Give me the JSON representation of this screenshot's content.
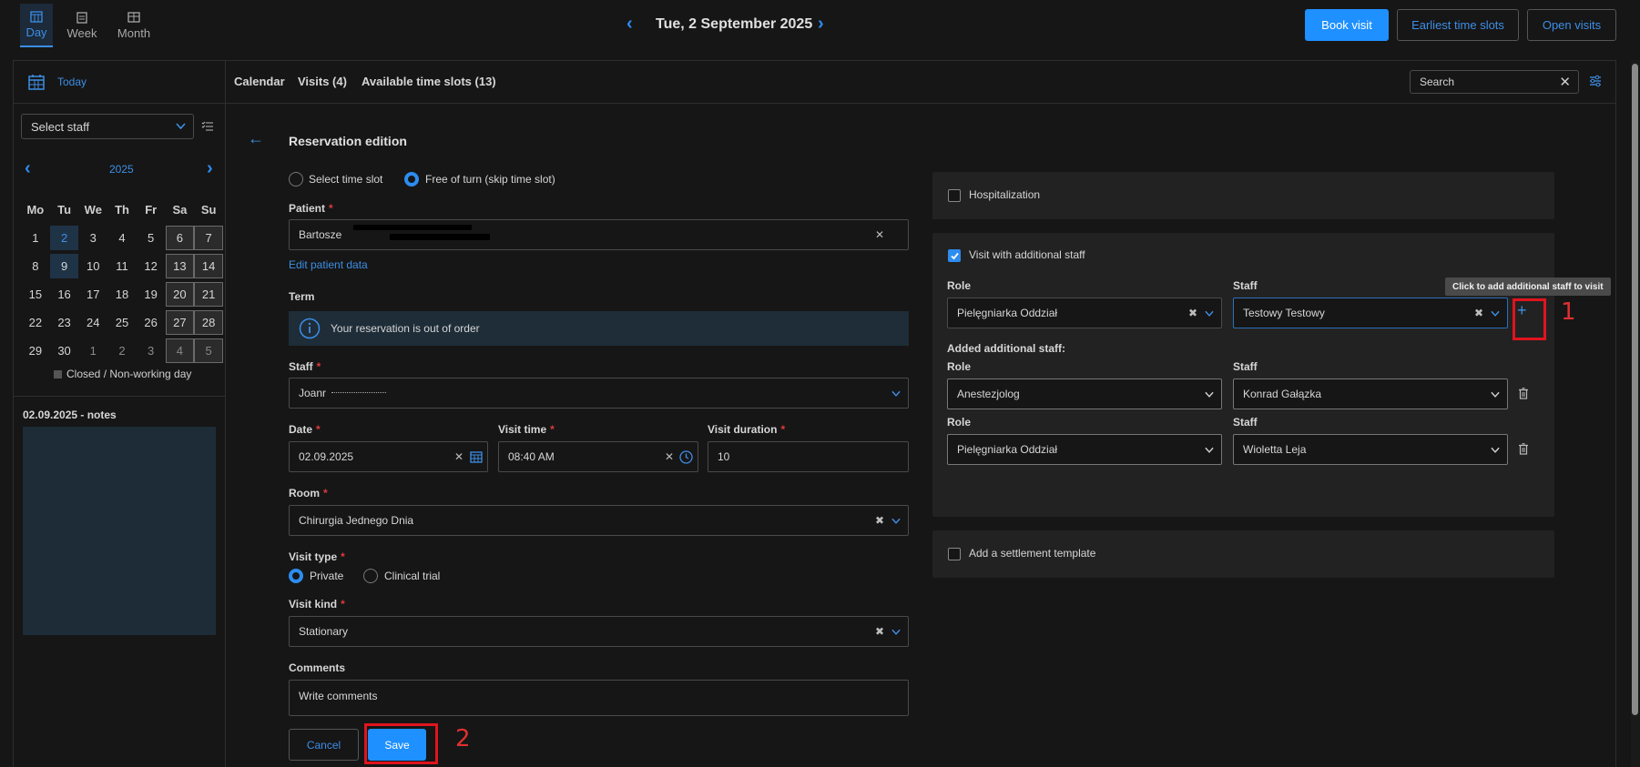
{
  "views": [
    {
      "label": "Day",
      "icon": "calendar-day-icon",
      "active": true
    },
    {
      "label": "Week",
      "icon": "calendar-week-icon",
      "active": false
    },
    {
      "label": "Month",
      "icon": "calendar-month-icon",
      "active": false
    }
  ],
  "header": {
    "date_title": "Tue, 2 September 2025"
  },
  "top_buttons": {
    "book_visit": "Book visit",
    "earliest": "Earliest time slots",
    "open_visits": "Open visits"
  },
  "sidebar": {
    "today": "Today",
    "select_staff": "Select staff",
    "year": "2025",
    "weekdays": [
      "Mo",
      "Tu",
      "We",
      "Th",
      "Fr",
      "Sa",
      "Su"
    ],
    "weeks": [
      [
        "1",
        "2",
        "3",
        "4",
        "5",
        "6",
        "7"
      ],
      [
        "8",
        "9",
        "10",
        "11",
        "12",
        "13",
        "14"
      ],
      [
        "15",
        "16",
        "17",
        "18",
        "19",
        "20",
        "21"
      ],
      [
        "22",
        "23",
        "24",
        "25",
        "26",
        "27",
        "28"
      ],
      [
        "29",
        "30",
        "1",
        "2",
        "3",
        "4",
        "5"
      ]
    ],
    "legend": "Closed / Non-working day",
    "notes_title": "02.09.2025 - notes"
  },
  "tabs": {
    "calendar": "Calendar",
    "visits": "Visits (4)",
    "slots": "Available time slots (13)"
  },
  "search": {
    "placeholder": "Search"
  },
  "form": {
    "title": "Reservation edition",
    "mode_select": "Select time slot",
    "mode_free": "Free of turn (skip time slot)",
    "patient_label": "Patient",
    "patient_value": "Bartosze",
    "edit_patient": "Edit patient data",
    "term_label": "Term",
    "info_text": "Your reservation is out of order",
    "staff_label": "Staff",
    "staff_value": "Joanr",
    "date_label": "Date",
    "date_value": "02.09.2025",
    "time_label": "Visit time",
    "time_value": "08:40 AM",
    "duration_label": "Visit duration",
    "duration_value": "10",
    "room_label": "Room",
    "room_value": "Chirurgia Jednego Dnia",
    "type_label": "Visit type",
    "type_private": "Private",
    "type_trial": "Clinical trial",
    "kind_label": "Visit kind",
    "kind_value": "Stationary",
    "comments_label": "Comments",
    "comments_placeholder": "Write comments",
    "cancel": "Cancel",
    "save": "Save"
  },
  "right": {
    "hospitalization": "Hospitalization",
    "additional_staff": "Visit with additional staff",
    "role_label": "Role",
    "staff_label": "Staff",
    "role_value": "Pielęgniarka Oddział",
    "staff_value": "Testowy Testowy",
    "add_tooltip": "Click to add additional staff to visit",
    "added_title": "Added additional staff:",
    "added": [
      {
        "role": "Anestezjolog",
        "staff": "Konrad Gałązka"
      },
      {
        "role": "Pielęgniarka Oddział",
        "staff": "Wioletta Leja"
      }
    ],
    "settlement": "Add a settlement template"
  },
  "annotations": {
    "one": "1",
    "two": "2"
  },
  "colors": {
    "accent": "#1e90ff",
    "annotation": "#e0141e",
    "required": "#e0393e"
  }
}
